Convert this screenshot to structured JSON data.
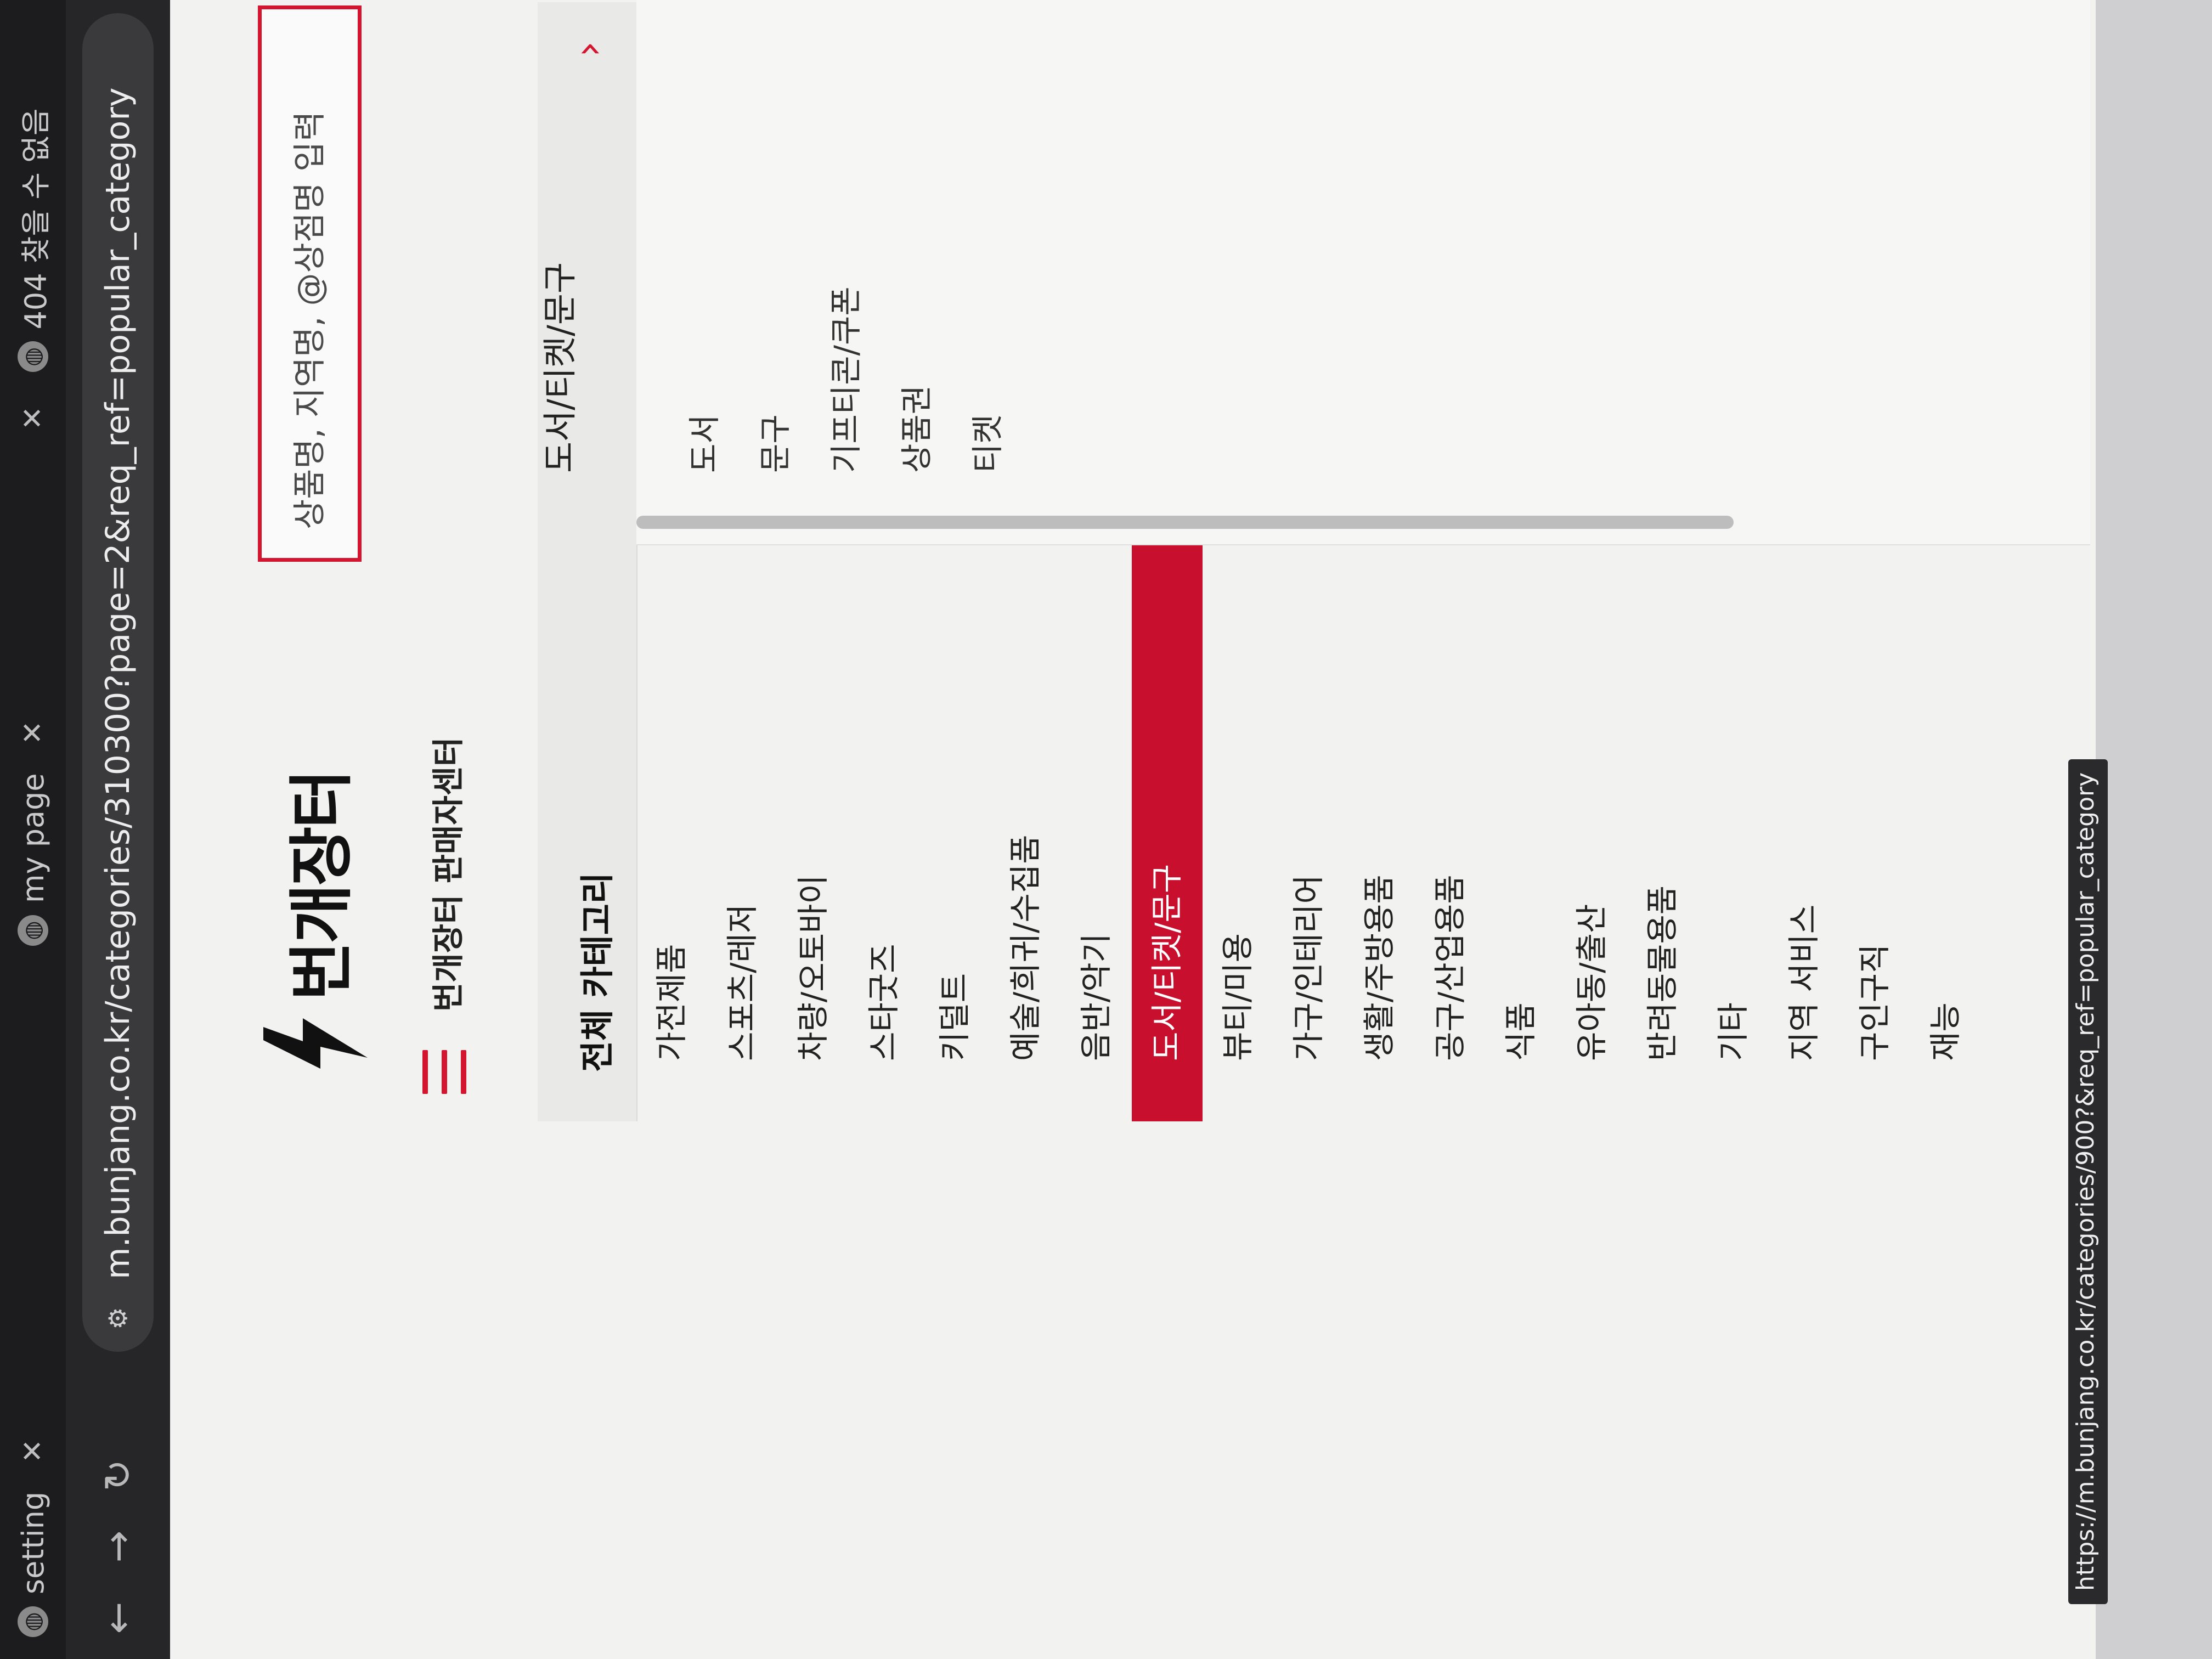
{
  "browser": {
    "tabs": [
      {
        "title": "setting"
      },
      {
        "title": "my page"
      },
      {
        "title": "404 찾을 수 없음"
      }
    ],
    "url": "m.bunjang.co.kr/categories/310300?page=2&req_ref=popular_category",
    "status_url": "https://m.bunjang.co.kr/categories/900?&req_ref=popular_category"
  },
  "header": {
    "logo_text": "번개장터",
    "search_placeholder": "상품명, 지역명, @상점명 입력",
    "seller_center": "번개장터 판매자센터"
  },
  "categories": {
    "title": "전체 카테고리",
    "arrow": "›",
    "items": [
      "가전제품",
      "스포츠/레저",
      "차량/오토바이",
      "스타굿즈",
      "키덜트",
      "예술/희귀/수집품",
      "음반/악기",
      "도서/티켓/문구",
      "뷰티/미용",
      "가구/인테리어",
      "생활/주방용품",
      "공구/산업용품",
      "식품",
      "유아동/출산",
      "반려동물용품",
      "기타",
      "지역 서비스",
      "구인구직",
      "재능"
    ],
    "active_index": 7
  },
  "subcategories": {
    "title": "도서/티켓/문구",
    "items": [
      "도서",
      "문구",
      "기프티콘/쿠폰",
      "상품권",
      "티켓"
    ]
  },
  "colors": {
    "brand": "#d4152f",
    "active_bg": "#c8102e"
  }
}
